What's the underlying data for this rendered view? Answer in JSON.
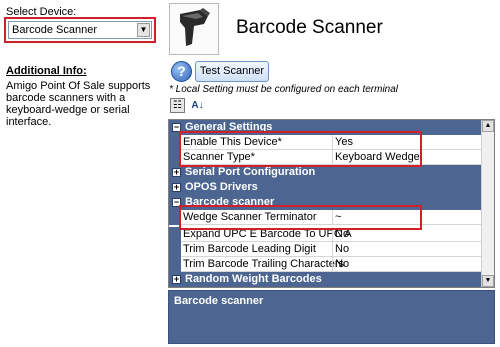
{
  "left": {
    "select_label": "Select Device:",
    "selected_device": "Barcode Scanner",
    "info_title": "Additional Info:",
    "info_text": "Amigo Point Of Sale supports barcode scanners with a keyboard-wedge or serial interface."
  },
  "header": {
    "title": "Barcode Scanner",
    "image_icon": "barcode-scanner-image"
  },
  "toolbar": {
    "help_icon": "question-icon",
    "test_button": "Test Scanner",
    "note": "* Local Setting must be configured on each terminal",
    "categorized_icon": "categorized-view-icon",
    "alphabetical_icon": "sort-alphabetical-icon"
  },
  "grid": {
    "categories": {
      "general": "General Settings",
      "serial": "Serial Port Configuration",
      "opos": "OPOS Drivers",
      "barcode": "Barcode scanner",
      "random": "Random Weight Barcodes"
    },
    "rows": {
      "enable": {
        "name": "Enable This Device*",
        "value": "Yes"
      },
      "type": {
        "name": "Scanner Type*",
        "value": "Keyboard Wedge"
      },
      "terminator": {
        "name": "Wedge Scanner Terminator",
        "value": "~"
      },
      "expand": {
        "name": "Expand UPC E Barcode To UPC A",
        "value": "No"
      },
      "trim_lead": {
        "name": "Trim Barcode Leading Digit",
        "value": "No"
      },
      "trim_trail": {
        "name": "Trim Barcode Trailing Characters",
        "value": "No"
      }
    }
  },
  "description": {
    "title": "Barcode scanner"
  },
  "colors": {
    "category_bg": "#4d6691",
    "highlight": "#d0202a"
  }
}
